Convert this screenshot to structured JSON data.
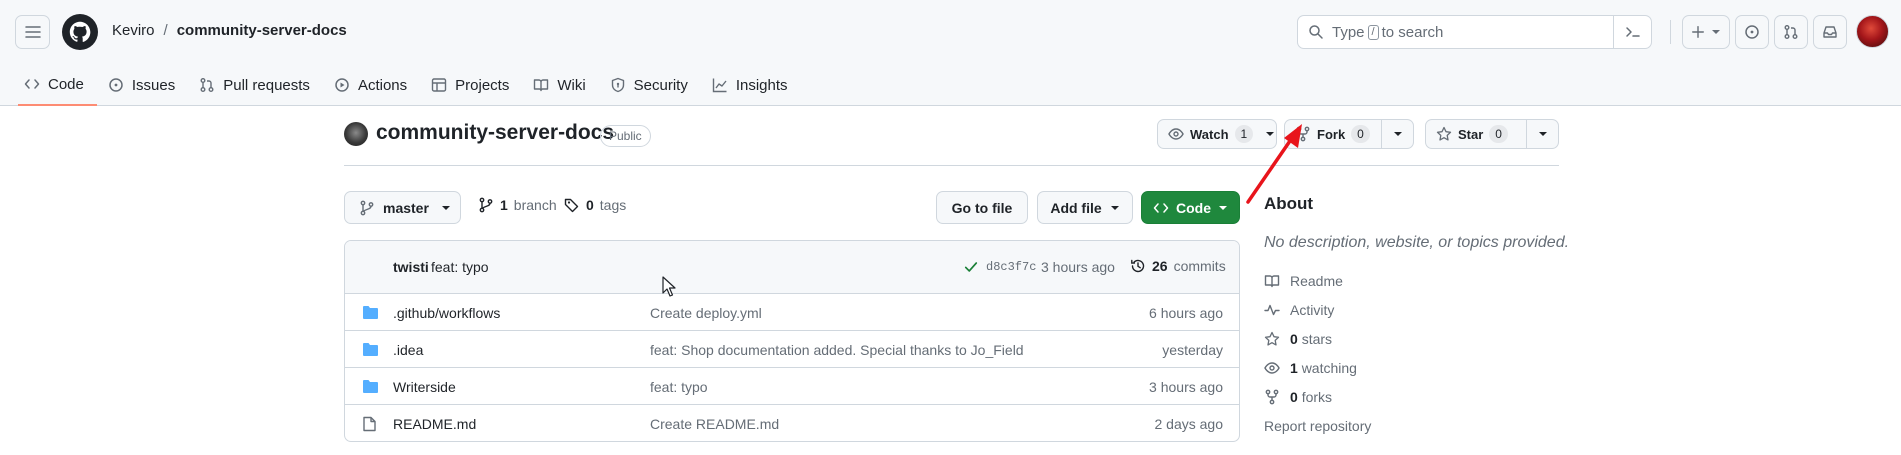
{
  "header": {
    "owner": "Keviro",
    "separator": "/",
    "repo": "community-server-docs",
    "search_placeholder_before": "Type",
    "search_key": "/",
    "search_placeholder_after": "to search"
  },
  "nav": {
    "tabs": [
      {
        "label": "Code",
        "icon": "code-icon",
        "selected": true
      },
      {
        "label": "Issues",
        "icon": "issue-icon"
      },
      {
        "label": "Pull requests",
        "icon": "pull-request-icon"
      },
      {
        "label": "Actions",
        "icon": "play-icon"
      },
      {
        "label": "Projects",
        "icon": "table-icon"
      },
      {
        "label": "Wiki",
        "icon": "book-icon"
      },
      {
        "label": "Security",
        "icon": "shield-icon"
      },
      {
        "label": "Insights",
        "icon": "graph-icon"
      }
    ]
  },
  "repo_head": {
    "title": "community-server-docs",
    "visibility": "Public",
    "watch_label": "Watch",
    "watch_count": "1",
    "fork_label": "Fork",
    "fork_count": "0",
    "star_label": "Star",
    "star_count": "0"
  },
  "branch_bar": {
    "branch": "master",
    "branch_count": "1",
    "branch_word": "branch",
    "tag_count": "0",
    "tag_word": "tags",
    "goto_file": "Go to file",
    "add_file": "Add file",
    "code": "Code"
  },
  "latest_commit": {
    "author": "twisti",
    "message": "feat: typo",
    "sha": "d8c3f7c",
    "ago": "3 hours ago",
    "commit_count": "26",
    "commit_word": "commits"
  },
  "files": [
    {
      "name": ".github/workflows",
      "type": "folder",
      "message": "Create deploy.yml",
      "ago": "6 hours ago"
    },
    {
      "name": ".idea",
      "type": "folder",
      "message": "feat: Shop documentation added. Special thanks to Jo_Field",
      "ago": "yesterday"
    },
    {
      "name": "Writerside",
      "type": "folder",
      "message": "feat: typo",
      "ago": "3 hours ago"
    },
    {
      "name": "README.md",
      "type": "file",
      "message": "Create README.md",
      "ago": "2 days ago"
    }
  ],
  "about": {
    "title": "About",
    "description": "No description, website, or topics provided.",
    "readme": "Readme",
    "activity": "Activity",
    "stars_count": "0",
    "stars_word": "stars",
    "watching_count": "1",
    "watching_word": "watching",
    "forks_count": "0",
    "forks_word": "forks",
    "report": "Report repository"
  },
  "colors": {
    "accent_tab": "#fd8c73",
    "code_button": "#1f883d",
    "folder": "#54aeff",
    "annotation_arrow": "#e8141b"
  }
}
